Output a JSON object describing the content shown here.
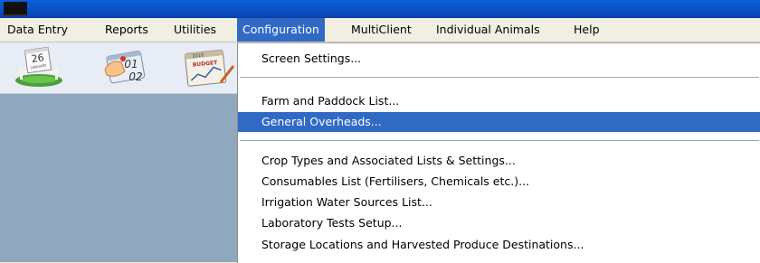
{
  "menubar": {
    "items": [
      {
        "label": "Data Entry"
      },
      {
        "label": "Reports"
      },
      {
        "label": "Utilities"
      },
      {
        "label": "Configuration"
      },
      {
        "label": "MultiClient"
      },
      {
        "label": "Individual Animals"
      },
      {
        "label": "Help"
      }
    ]
  },
  "toolbar": {
    "calendar_day": "26",
    "calendar_month": "JANUARY",
    "date_from": "01",
    "date_to": "02",
    "budget_year": "2010",
    "budget_label": "BUDGET"
  },
  "dropdown": {
    "items": [
      {
        "label": "Screen Settings..."
      },
      {
        "label": "Farm and Paddock List..."
      },
      {
        "label": "General Overheads..."
      },
      {
        "label": "Crop Types and Associated Lists & Settings..."
      },
      {
        "label": "Consumables List (Fertilisers, Chemicals etc.)..."
      },
      {
        "label": "Irrigation Water Sources List..."
      },
      {
        "label": "Laboratory Tests Setup..."
      },
      {
        "label": "Storage Locations and Harvested Produce Destinations..."
      }
    ]
  },
  "colors": {
    "highlight": "#316ac5",
    "panel": "#8fa8bd",
    "menubar": "#f1efe2",
    "titlebar": "#0b4ec4"
  }
}
